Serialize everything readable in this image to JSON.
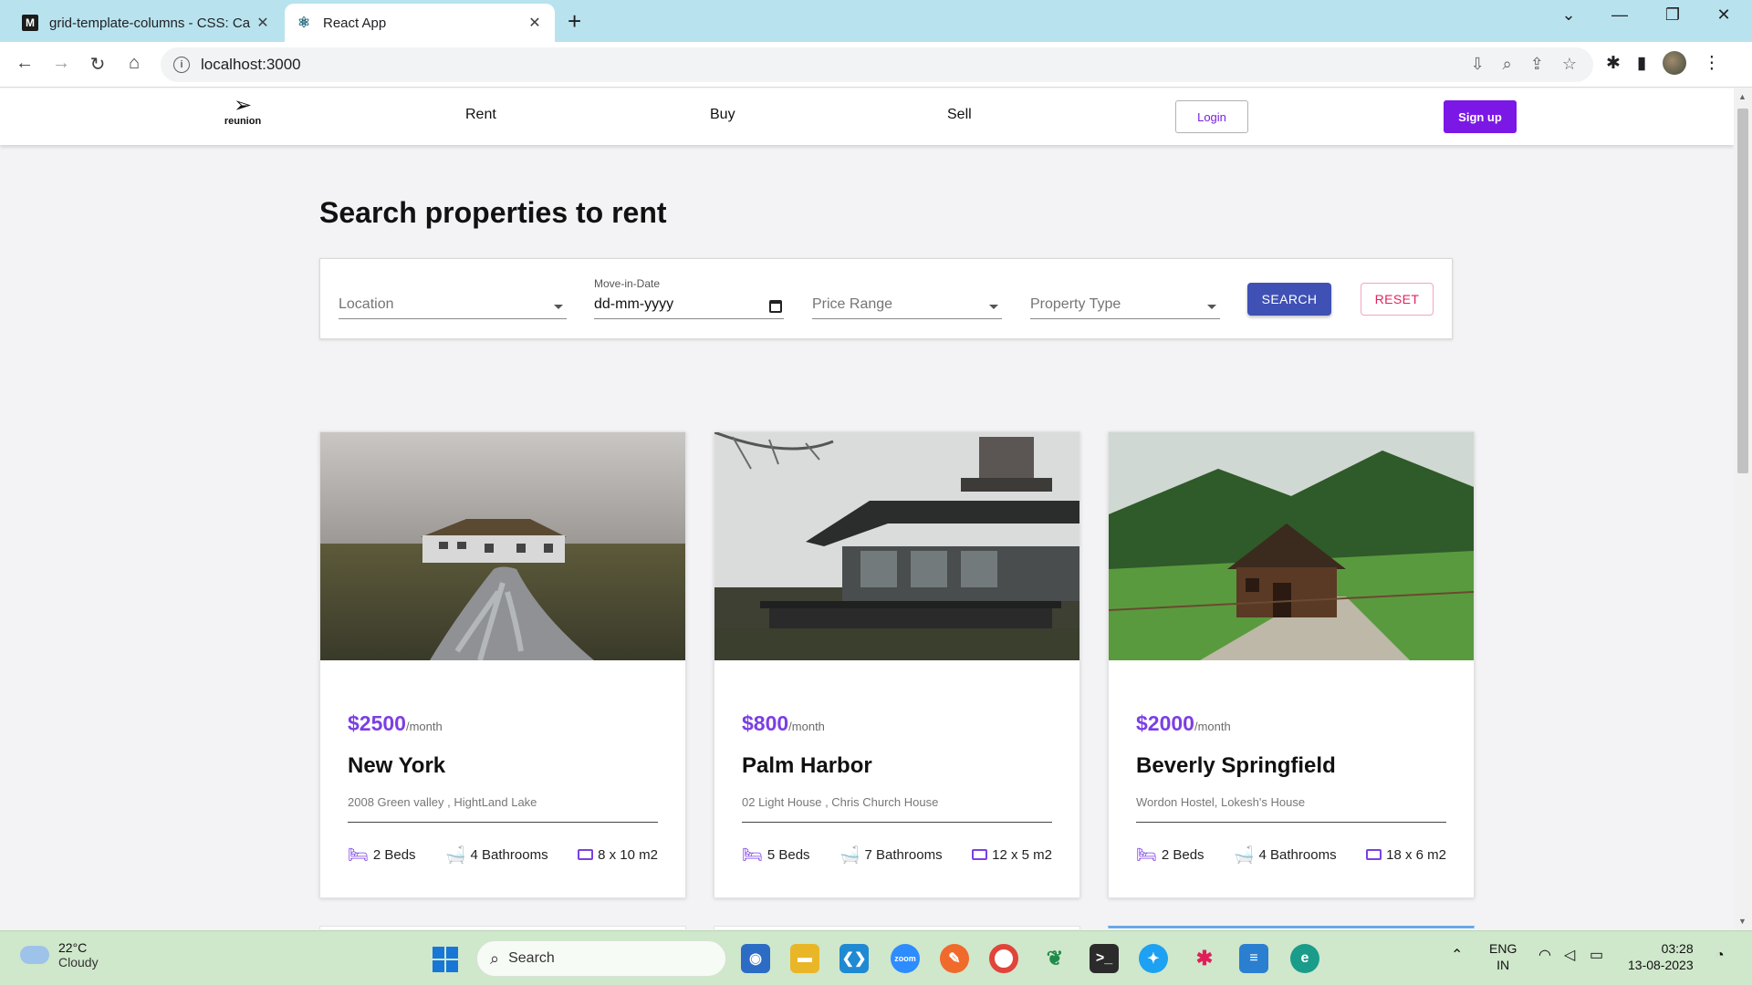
{
  "browser": {
    "tabs": [
      {
        "title": "grid-template-columns - CSS: Ca",
        "favicon": "M"
      },
      {
        "title": "React App",
        "favicon": "⚛"
      }
    ],
    "url": "localhost:3000"
  },
  "header": {
    "logo_text": "reunion",
    "nav": [
      "Rent",
      "Buy",
      "Sell"
    ],
    "login_label": "Login",
    "signup_label": "Sign up"
  },
  "page": {
    "title": "Search properties to rent"
  },
  "filters": {
    "location_placeholder": "Location",
    "date_label": "Move-in-Date",
    "date_value": "dd-mm-yyyy",
    "price_placeholder": "Price Range",
    "type_placeholder": "Property Type",
    "search_label": "SEARCH",
    "reset_label": "RESET"
  },
  "listings": [
    {
      "price": "$2500",
      "period": "/month",
      "name": "New York",
      "address": "2008 Green valley , HightLand Lake",
      "beds": "2 Beds",
      "baths": "4 Bathrooms",
      "area": "8 x 10 m2"
    },
    {
      "price": "$800",
      "period": "/month",
      "name": "Palm Harbor",
      "address": "02 Light House , Chris Church House",
      "beds": "5 Beds",
      "baths": "7 Bathrooms",
      "area": "12 x 5 m2"
    },
    {
      "price": "$2000",
      "period": "/month",
      "name": "Beverly Springfield",
      "address": "Wordon Hostel, Lokesh's House",
      "beds": "2 Beds",
      "baths": "4 Bathrooms",
      "area": "18 x 6 m2"
    }
  ],
  "taskbar": {
    "temperature": "22°C",
    "condition": "Cloudy",
    "search_label": "Search",
    "language": "ENG",
    "region": "IN",
    "time": "03:28",
    "date": "13-08-2023"
  },
  "colors": {
    "accent": "#7b18e6",
    "price": "#7b3fe4",
    "search_button": "#3f51b5",
    "reset": "#e0245e"
  }
}
